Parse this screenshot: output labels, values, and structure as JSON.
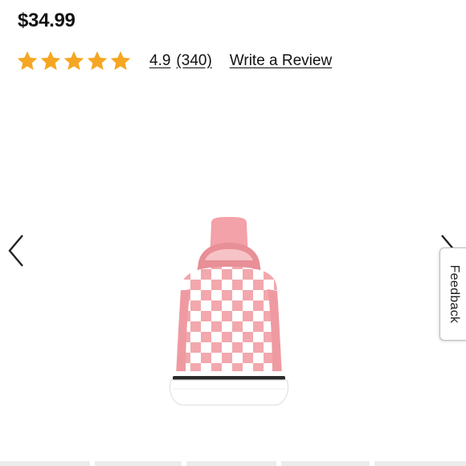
{
  "product": {
    "price": "$34.99",
    "rating": {
      "value": "4.9",
      "count": "(340)",
      "stars_filled": 5,
      "stars_total": 5,
      "star_color": "#f5a623"
    },
    "write_review_label": "Write a Review"
  },
  "gallery": {
    "prev_icon": "chevron-left-icon",
    "next_icon": "chevron-right-icon",
    "image_alt": "pink checkerboard slip-on sneaker",
    "thumbnails_visible": 5
  },
  "feedback": {
    "label": "Feedback"
  },
  "colors": {
    "text": "#111111",
    "star": "#f5a623",
    "shoe_pink": "#f2a8ad"
  }
}
